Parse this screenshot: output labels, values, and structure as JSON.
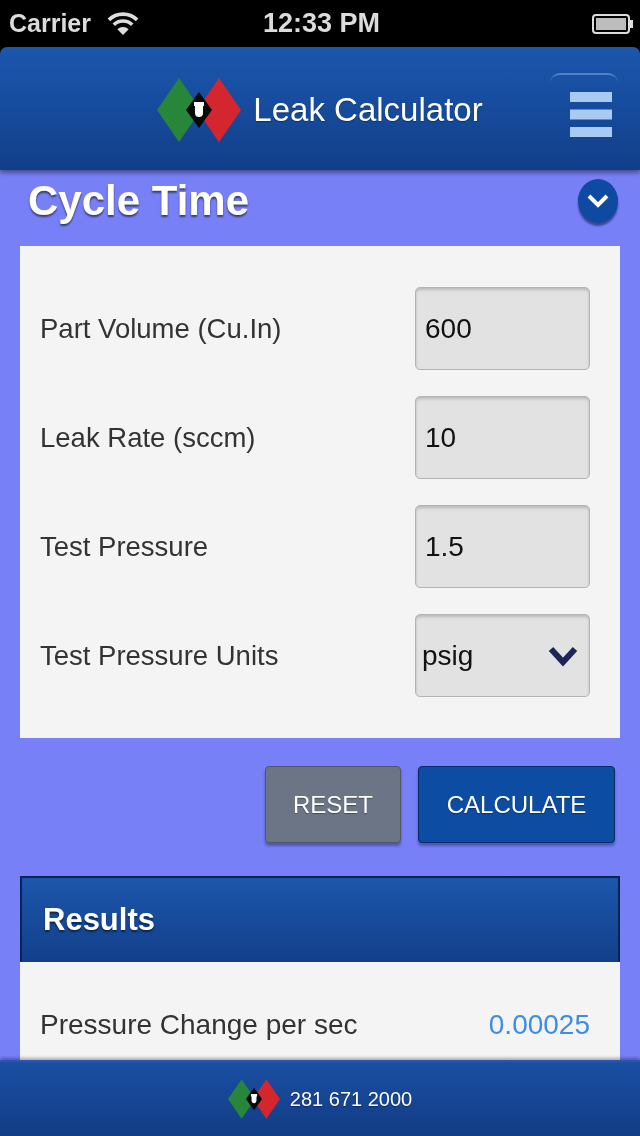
{
  "status_bar": {
    "carrier": "Carrier",
    "time": "12:33 PM"
  },
  "header": {
    "title": "Leak Calculator"
  },
  "section": {
    "title": "Cycle Time"
  },
  "form": {
    "fields": [
      {
        "kind": "input",
        "label": "Part Volume (Cu.In)",
        "value": "600"
      },
      {
        "kind": "input",
        "label": "Leak Rate (sccm)",
        "value": "10"
      },
      {
        "kind": "input",
        "label": "Test Pressure",
        "value": "1.5"
      },
      {
        "kind": "select",
        "label": "Test Pressure Units",
        "value": "psig"
      }
    ]
  },
  "buttons": [
    {
      "kind": "secondary",
      "label": "RESET"
    },
    {
      "kind": "primary",
      "label": "CALCULATE"
    }
  ],
  "results": {
    "title": "Results",
    "rows": [
      {
        "label": "Pressure Change per sec",
        "value": "0.00025"
      }
    ]
  },
  "footer": {
    "phone": "281 671 2000"
  }
}
